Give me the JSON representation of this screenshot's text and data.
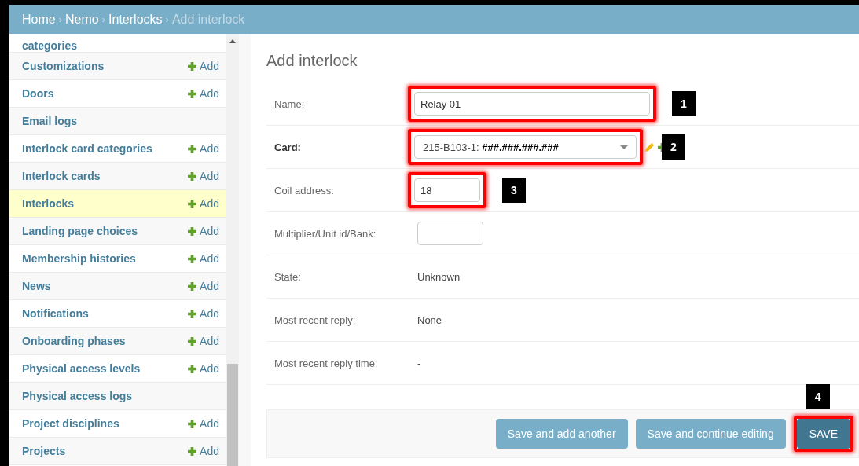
{
  "breadcrumbs": [
    {
      "label": "Home",
      "current": false
    },
    {
      "separator": "›",
      "label": "Nemo",
      "current": false
    },
    {
      "separator": "›",
      "label": "Interlocks",
      "current": false
    },
    {
      "separator": "›",
      "label": "Add interlock",
      "current": true
    }
  ],
  "sidebar": {
    "items": [
      {
        "label": "categories",
        "selected": false
      },
      {
        "label": "Customizations",
        "add": "Add",
        "selected": false
      },
      {
        "label": "Doors",
        "add": "Add",
        "selected": false
      },
      {
        "label": "Email logs",
        "selected": false
      },
      {
        "label": "Interlock card categories",
        "add": "Add",
        "selected": false
      },
      {
        "label": "Interlock cards",
        "add": "Add",
        "selected": false
      },
      {
        "label": "Interlocks",
        "add": "Add",
        "selected": true
      },
      {
        "label": "Landing page choices",
        "add": "Add",
        "selected": false
      },
      {
        "label": "Membership histories",
        "add": "Add",
        "selected": false
      },
      {
        "label": "News",
        "add": "Add",
        "selected": false
      },
      {
        "label": "Notifications",
        "add": "Add",
        "selected": false
      },
      {
        "label": "Onboarding phases",
        "add": "Add",
        "selected": false
      },
      {
        "label": "Physical access levels",
        "add": "Add",
        "selected": false
      },
      {
        "label": "Physical access logs",
        "selected": false
      },
      {
        "label": "Project disciplines",
        "add": "Add",
        "selected": false
      },
      {
        "label": "Projects",
        "add": "Add",
        "selected": false
      }
    ]
  },
  "form": {
    "title": "Add interlock",
    "fields": [
      {
        "label": "Name:",
        "kind": "text",
        "value": "Relay 01",
        "required": false,
        "highlighted": true,
        "callout": "1"
      },
      {
        "label": "Card:",
        "kind": "select",
        "value_prefix": "215-B103-1:",
        "value": "###.###.###.###",
        "required": true,
        "highlighted": true,
        "callout": "2"
      },
      {
        "label": "Coil address:",
        "kind": "number",
        "value": "18",
        "required": false,
        "highlighted": true,
        "callout": "3"
      },
      {
        "label": "Multiplier/Unit id/Bank:",
        "kind": "number",
        "required": false,
        "highlighted": false
      },
      {
        "label": "State:",
        "kind": "readonly",
        "value": "Unknown",
        "required": false
      },
      {
        "label": "Most recent reply:",
        "kind": "readonly",
        "value": "None",
        "required": false
      },
      {
        "label": "Most recent reply time:",
        "kind": "readonly",
        "value": "-",
        "required": false
      }
    ]
  },
  "buttons": [
    {
      "label": "Save and add another",
      "primary": false,
      "highlighted": false
    },
    {
      "label": "Save and continue editing",
      "primary": false,
      "highlighted": false
    },
    {
      "label": "SAVE",
      "primary": true,
      "highlighted": true,
      "callout": "4"
    }
  ]
}
